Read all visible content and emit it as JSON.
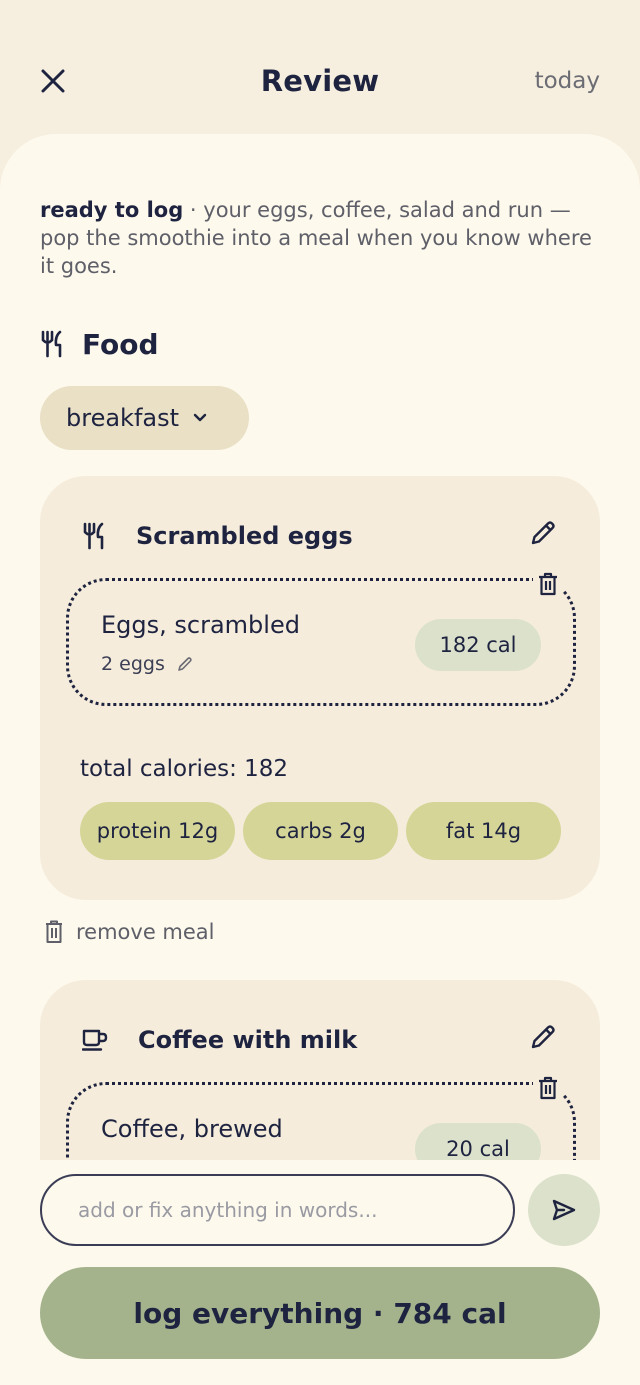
{
  "header": {
    "title": "Review",
    "date": "today",
    "close_icon": "close-icon"
  },
  "intro": {
    "status": "ready to log",
    "separator": " · ",
    "message": "your eggs, coffee, salad and run — pop the smoothie into a meal when you know where it goes."
  },
  "food_section": {
    "title": "Food",
    "icon": "fork-knife-icon",
    "meal_select": {
      "selected": "breakfast",
      "icon": "chevron-down-icon"
    }
  },
  "meals": [
    {
      "title": "Scrambled eggs",
      "icon": "fork-knife-icon",
      "items": [
        {
          "name": "Eggs, scrambled",
          "quantity": "2 eggs",
          "calories": "182 cal"
        }
      ],
      "total": "total calories: 182",
      "macros": [
        "protein 12g",
        "carbs 2g",
        "fat 14g"
      ],
      "remove_label": "remove meal"
    },
    {
      "title": "Coffee with milk",
      "icon": "coffee-cup-icon",
      "items": [
        {
          "name": "Coffee, brewed",
          "calories": "20 cal"
        }
      ]
    }
  ],
  "composer": {
    "placeholder": "add or fix anything in words...",
    "send_icon": "send-icon"
  },
  "primary_action": {
    "label": "log everything · 784 cal"
  },
  "colors": {
    "background": "#f6efdf",
    "sheet": "#fdf9ed",
    "card": "#f5ecdb",
    "text": "#1e2340",
    "macro_pill": "#d5d598",
    "calorie_pill": "#dbe1cb",
    "primary_button": "#a4b38c"
  }
}
